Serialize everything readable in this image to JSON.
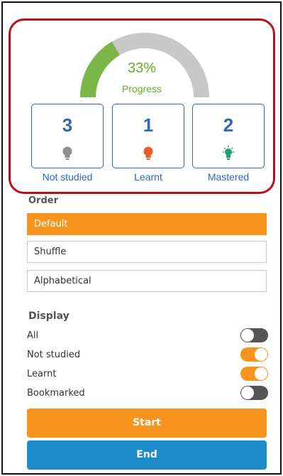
{
  "progress": {
    "percent_text": "33%",
    "label": "Progress",
    "fraction": 0.33,
    "fill_color": "#7ab648",
    "track_color": "#c8c8c8"
  },
  "stats": [
    {
      "count": "3",
      "label": "Not studied",
      "icon": "bulb-icon",
      "icon_color": "#8f8f8f"
    },
    {
      "count": "1",
      "label": "Learnt",
      "icon": "bulb-icon",
      "icon_color": "#f05a28"
    },
    {
      "count": "2",
      "label": "Mastered",
      "icon": "bulb-glowing-icon",
      "icon_color": "#1aa37a"
    }
  ],
  "order": {
    "title": "Order",
    "options": [
      "Default",
      "Shuffle",
      "Alphabetical"
    ],
    "selected": "Default"
  },
  "display": {
    "title": "Display",
    "items": [
      {
        "label": "All",
        "on": false
      },
      {
        "label": "Not studied",
        "on": true
      },
      {
        "label": "Learnt",
        "on": true
      },
      {
        "label": "Bookmarked",
        "on": false
      }
    ]
  },
  "actions": {
    "start_label": "Start",
    "end_label": "End"
  },
  "colors": {
    "accent": "#f7941d",
    "blue": "#2f68b8",
    "end_button": "#1d8bc7",
    "highlight_border": "#b3131f"
  }
}
